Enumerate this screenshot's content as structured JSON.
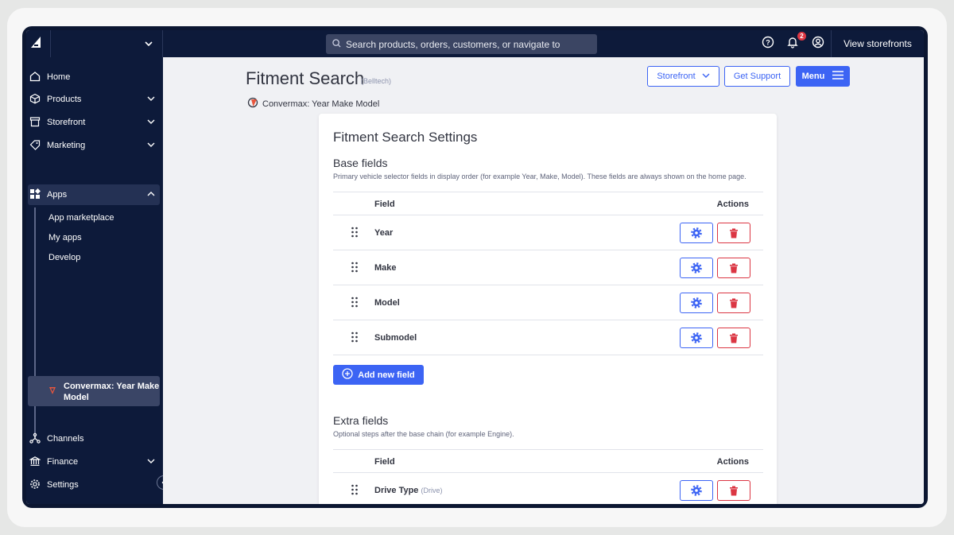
{
  "topbar": {
    "search_placeholder": "Search products, orders, customers, or navigate to",
    "notification_count": "2",
    "view_storefronts": "View storefronts"
  },
  "sidebar": {
    "items": [
      {
        "label": "Home",
        "icon": "home-icon"
      },
      {
        "label": "Products",
        "icon": "box-icon"
      },
      {
        "label": "Storefront",
        "icon": "storefront-icon"
      },
      {
        "label": "Marketing",
        "icon": "tag-icon"
      },
      {
        "label": "Apps",
        "icon": "apps-icon"
      },
      {
        "label": "Channels",
        "icon": "channels-icon"
      },
      {
        "label": "Finance",
        "icon": "bank-icon"
      },
      {
        "label": "Settings",
        "icon": "gear-icon"
      }
    ],
    "apps_sub": [
      "App marketplace",
      "My apps",
      "Develop"
    ],
    "active_app": "Convermax: Year Make Model"
  },
  "page": {
    "title": "Fitment Search",
    "subtitle": "(Belltech)",
    "provider": "Convermax: Year Make Model",
    "storefront_btn": "Storefront",
    "support_btn": "Get Support",
    "menu_btn": "Menu"
  },
  "card": {
    "title": "Fitment Search Settings",
    "base": {
      "title": "Base fields",
      "desc": "Primary vehicle selector fields in display order (for example Year, Make, Model). These fields are always shown on the home page.",
      "col_field": "Field",
      "col_actions": "Actions",
      "rows": [
        "Year",
        "Make",
        "Model",
        "Submodel"
      ]
    },
    "add_btn": "Add new field",
    "extra": {
      "title": "Extra fields",
      "desc": "Optional steps after the base chain (for example Engine).",
      "col_field": "Field",
      "col_actions": "Actions",
      "rows": [
        {
          "name": "Drive Type",
          "hint": "(Drive)"
        }
      ]
    }
  },
  "colors": {
    "accent": "#3c64f4",
    "danger": "#db3643",
    "nav": "#0d1a3a"
  }
}
